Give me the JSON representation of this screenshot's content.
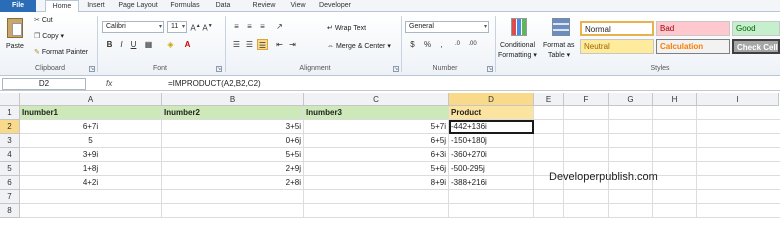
{
  "tabs": [
    "File",
    "Home",
    "Insert",
    "Page Layout",
    "Formulas",
    "Data",
    "Review",
    "View",
    "Developer"
  ],
  "ribbon": {
    "clipboard": {
      "paste": "Paste",
      "cut": "Cut",
      "copy": "Copy",
      "format_painter": "Format Painter",
      "label": "Clipboard"
    },
    "font": {
      "name": "Calibri",
      "size": "11",
      "label": "Font"
    },
    "alignment": {
      "wrap_text": "Wrap Text",
      "merge_center": "Merge & Center",
      "label": "Alignment"
    },
    "number": {
      "format": "General",
      "label": "Number"
    },
    "conditional_formatting_1": "Conditional",
    "conditional_formatting_2": "Formatting",
    "format_as_table_1": "Format as",
    "format_as_table_2": "Table",
    "styles": {
      "normal": "Normal",
      "bad": "Bad",
      "good": "Good",
      "neutral": "Neutral",
      "calculation": "Calculation",
      "check_cell": "Check Cell",
      "label": "Styles"
    }
  },
  "formula_bar": {
    "name_box": "D2",
    "fx": "fx",
    "formula": "=IMPRODUCT(A2,B2,C2)"
  },
  "columns": [
    "A",
    "B",
    "C",
    "D",
    "E",
    "F",
    "G",
    "H",
    "I"
  ],
  "rows": [
    "1",
    "2",
    "3",
    "4",
    "5",
    "6",
    "7",
    "8"
  ],
  "sheet": {
    "headers": [
      "Inumber1",
      "Inumber2",
      "Inumber3",
      "Product"
    ],
    "data": [
      [
        "6+7i",
        "3+5i",
        "5+7i",
        "-442+136i"
      ],
      [
        "5",
        "0+6j",
        "6+5j",
        "-150+180j"
      ],
      [
        "3+9i",
        "5+5i",
        "6+3i",
        "-360+270i"
      ],
      [
        "1+8j",
        "2+9j",
        "5+6j",
        "-500-295j"
      ],
      [
        "4+2i",
        "2+8i",
        "8+9i",
        "-388+216i"
      ]
    ]
  },
  "watermark": "Developerpublish.com",
  "colors": {
    "file_tab": "#2a6cb5",
    "header_fill": "#cde9b9",
    "product_fill": "#fbe3a0",
    "selected_header": "#f9d98a"
  }
}
